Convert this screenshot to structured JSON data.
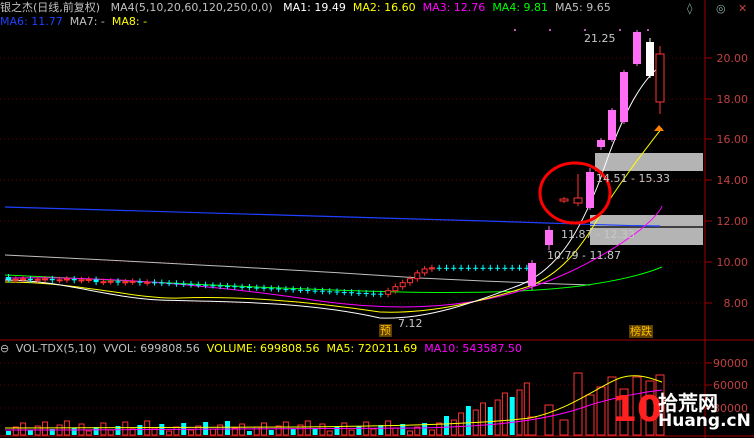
{
  "header": {
    "stock_name": "银之杰(日线,前复权)",
    "ma4_params": "MA4(5,10,20,60,120,250,0,0)",
    "indicators": [
      {
        "label": "MA1: 19.49",
        "color": "#ffffff"
      },
      {
        "label": "MA2: 16.60",
        "color": "#ffff00"
      },
      {
        "label": "MA3: 12.76",
        "color": "#ff00ff"
      },
      {
        "label": "MA4: 9.81",
        "color": "#00ff00"
      },
      {
        "label": "MA5: 9.65",
        "color": "#c0c0c0"
      }
    ],
    "indicators_row2": [
      {
        "label": "MA6: 11.77",
        "color": "#2040ff"
      },
      {
        "label": "MA7: -",
        "color": "#c0c0c0"
      },
      {
        "label": "MA8: -",
        "color": "#ffff00"
      }
    ]
  },
  "price_axis": {
    "ticks": [
      "20.00",
      "18.00",
      "16.00",
      "14.00",
      "12.00",
      "10.00",
      "8.00"
    ]
  },
  "annotations": {
    "high_label": "21.25",
    "low_label": "7.12",
    "band1_label": "14.51 - 15.33",
    "band2_label": "11.87 - 12.33",
    "band3_label": "10.79 - 11.87",
    "badge_yu": "预",
    "badge_bangdie": "榜跌"
  },
  "volume_header": {
    "items": [
      {
        "label": "VOL-TDX(5,10)",
        "color": "#c0c0c0"
      },
      {
        "label": "VVOL: 699808.56",
        "color": "#c0c0c0"
      },
      {
        "label": "VOLUME: 699808.56",
        "color": "#ffff00"
      },
      {
        "label": "MA5: 720211.69",
        "color": "#ffff00"
      },
      {
        "label": "MA10: 543587.50",
        "color": "#ff00ff"
      }
    ]
  },
  "volume_axis": {
    "ticks": [
      "90000",
      "60000",
      "30000"
    ]
  },
  "watermark": {
    "top": "拾荒网",
    "bottom": "Huang.cN"
  },
  "colors": {
    "up": "#ff3232",
    "down": "#00ffff",
    "limit_up": "#ff6ef5",
    "highlight_circle": "#ff0000",
    "band_fill": "#c8c8c8"
  }
}
